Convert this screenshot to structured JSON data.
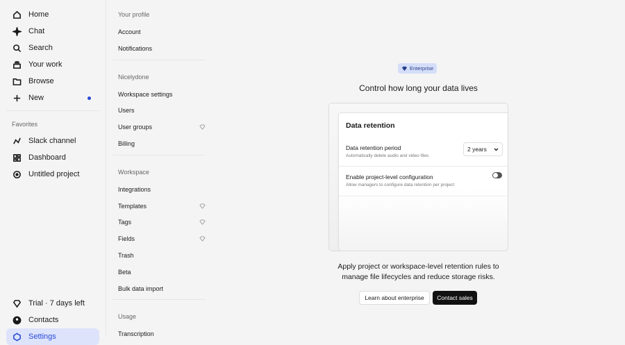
{
  "sidebar": {
    "nav": [
      {
        "label": "Home",
        "icon": "home-icon"
      },
      {
        "label": "Chat",
        "icon": "sparkle-icon"
      },
      {
        "label": "Search",
        "icon": "search-icon"
      },
      {
        "label": "Your work",
        "icon": "stack-icon"
      },
      {
        "label": "Browse",
        "icon": "folder-icon"
      },
      {
        "label": "New",
        "icon": "plus-icon"
      }
    ],
    "favorites_label": "Favorites",
    "favorites": [
      {
        "label": "Slack channel"
      },
      {
        "label": "Dashboard"
      },
      {
        "label": "Untitled project"
      }
    ],
    "bottom": [
      {
        "label": "Trial · 7 days left"
      },
      {
        "label": "Contacts"
      },
      {
        "label": "Settings"
      }
    ]
  },
  "settings_nav": {
    "sections": [
      {
        "title": "Your profile",
        "items": [
          "Account",
          "Notifications"
        ]
      },
      {
        "title": "Nicelydone",
        "items": [
          "Workspace settings",
          "Users",
          "User groups",
          "Billing"
        ]
      },
      {
        "title": "Workspace",
        "items": [
          "Integrations",
          "Templates",
          "Tags",
          "Fields",
          "Trash",
          "Beta",
          "Bulk data import"
        ]
      },
      {
        "title": "Usage",
        "items": [
          "Transcription"
        ]
      }
    ]
  },
  "main": {
    "badge": "Enterprise",
    "title": "Control how long your data lives",
    "card": {
      "heading": "Data retention",
      "period_label": "Data retention period",
      "period_sub": "Automatically delete audio and video files",
      "period_value": "2 years",
      "config_label": "Enable project-level configuration",
      "config_sub": "Allow managers to configure data retention per project",
      "config_enabled": false
    },
    "description": "Apply project or workspace-level retention rules to manage file lifecycles and reduce storage risks.",
    "learn_button": "Learn about enterprise",
    "contact_button": "Contact sales"
  },
  "colors": {
    "accent": "#2a4bd8",
    "active_bg": "#dde3fb",
    "badge_bg": "#d4def9"
  }
}
